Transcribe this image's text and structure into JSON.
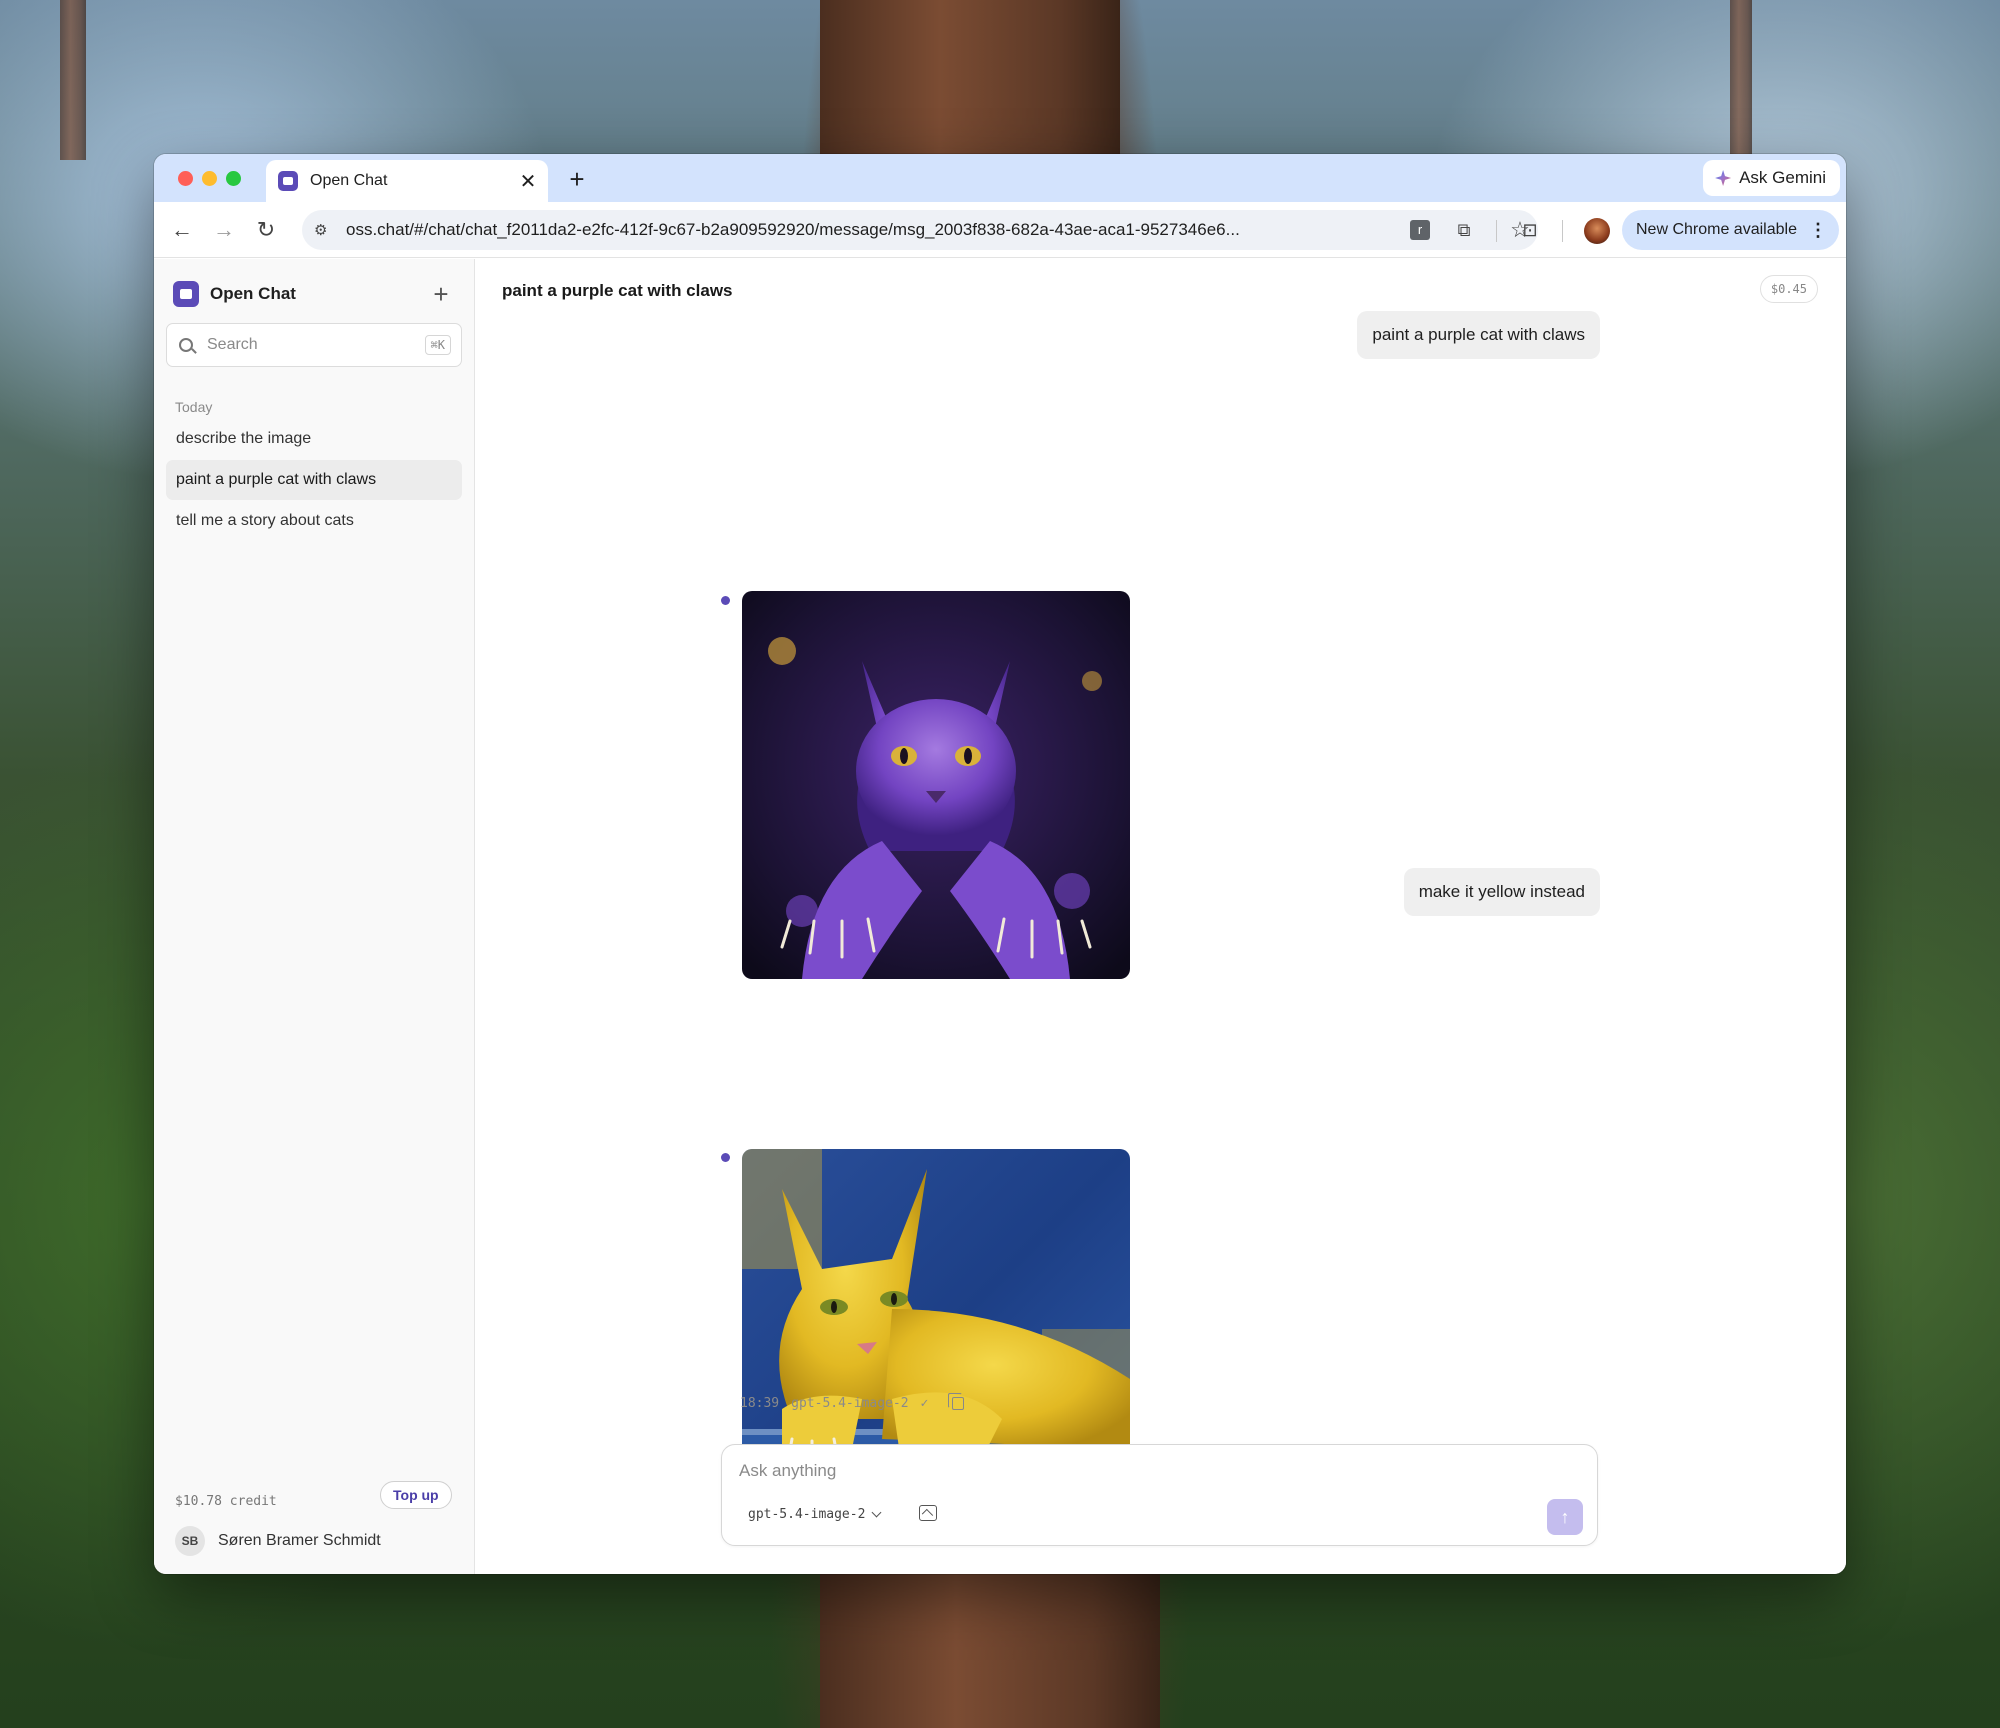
{
  "browser": {
    "tab_title": "Open Chat",
    "tab_close": "✕",
    "new_tab": "+",
    "ask_gemini": "Ask Gemini",
    "url": "oss.chat/#/chat/chat_f2011da2-e2fc-412f-9c67-b2a909592920/message/msg_2003f838-682a-43ae-aca1-9527346e6...",
    "update_label": "New Chrome available",
    "ext_letter": "r"
  },
  "sidebar": {
    "brand": "Open Chat",
    "new_chat": "+",
    "search_placeholder": "Search",
    "search_shortcut": "⌘K",
    "section": "Today",
    "conversations": [
      {
        "label": "describe the image"
      },
      {
        "label": "paint a purple cat with claws"
      },
      {
        "label": "tell me a story about cats"
      }
    ],
    "credit": "$10.78 credit",
    "top_up": "Top up",
    "user_initials": "SB",
    "user_name": "Søren Bramer Schmidt"
  },
  "chat": {
    "title": "paint a purple cat with claws",
    "cost": "$0.45",
    "messages": [
      {
        "role": "user",
        "text": "paint a purple cat with claws"
      },
      {
        "role": "assistant",
        "image": "purple-cat-image"
      },
      {
        "role": "user",
        "text": "make it yellow instead"
      },
      {
        "role": "assistant",
        "image": "yellow-cat-image"
      }
    ],
    "meta_time": "18:39",
    "meta_model": "gpt-5.4-image-2",
    "meta_check": "✓"
  },
  "composer": {
    "placeholder": "Ask anything",
    "model": "gpt-5.4-image-2",
    "send": "↑"
  },
  "colors": {
    "accent": "#5b4bb7",
    "tabstrip": "#d3e3fd",
    "send_disabled": "#c4bdee"
  }
}
